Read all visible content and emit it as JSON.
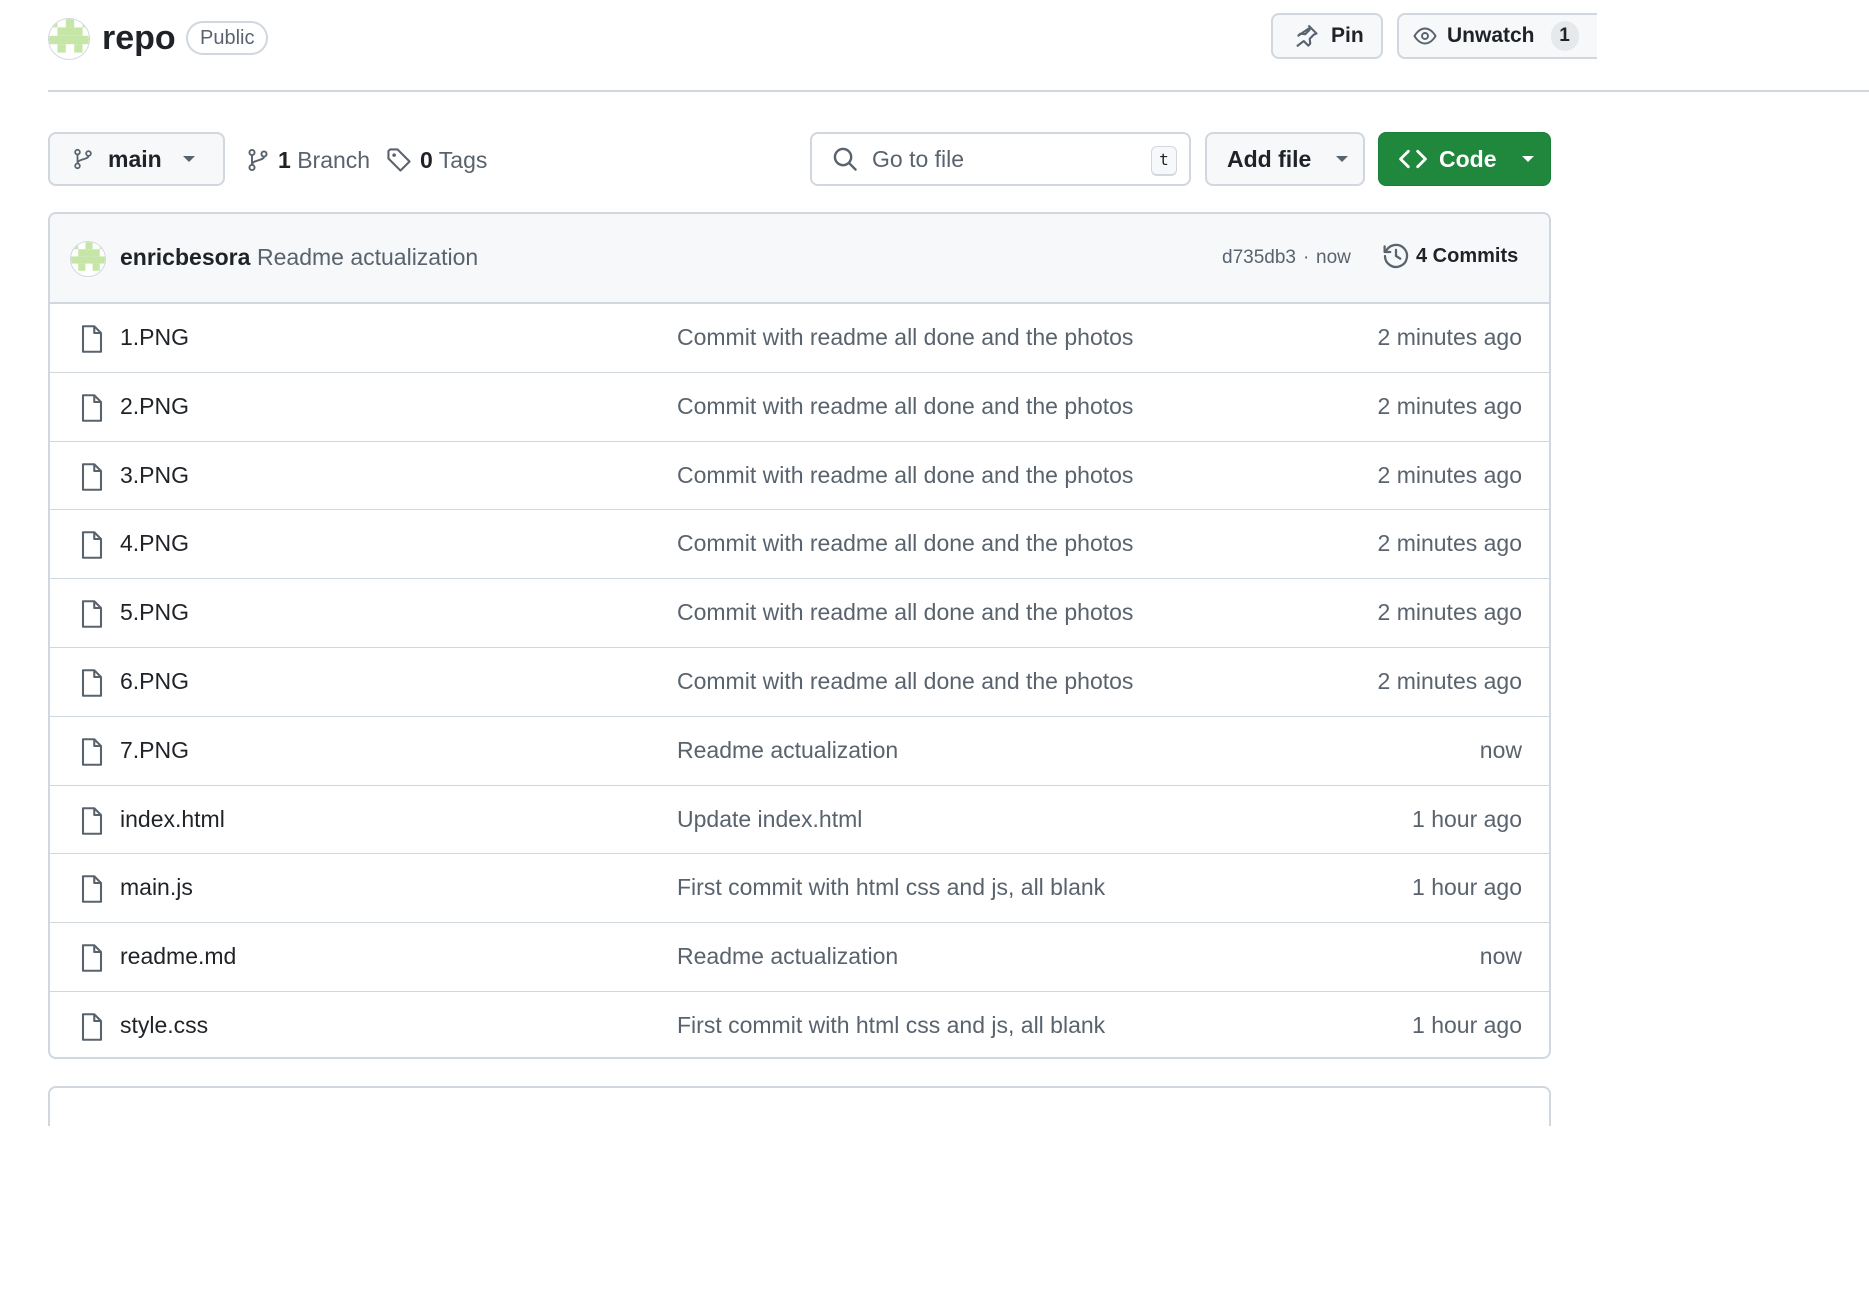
{
  "repo": {
    "name": "repo",
    "visibility": "Public",
    "pin_label": "Pin",
    "watch_label": "Unwatch",
    "watch_count": "1"
  },
  "toolbar": {
    "branch": "main",
    "branches_count": "1",
    "branches_label": "Branch",
    "tags_count": "0",
    "tags_label": "Tags",
    "search_placeholder": "Go to file",
    "search_shortcut": "t",
    "add_file_label": "Add file",
    "code_label": "Code"
  },
  "latest_commit": {
    "author": "enricbesora",
    "message": "Readme actualization",
    "sha": "d735db3",
    "separator": "·",
    "time": "now",
    "commits_label": "4 Commits"
  },
  "files": [
    {
      "name": "1.PNG",
      "commit": "Commit with readme all done and the photos",
      "age": "2 minutes ago"
    },
    {
      "name": "2.PNG",
      "commit": "Commit with readme all done and the photos",
      "age": "2 minutes ago"
    },
    {
      "name": "3.PNG",
      "commit": "Commit with readme all done and the photos",
      "age": "2 minutes ago"
    },
    {
      "name": "4.PNG",
      "commit": "Commit with readme all done and the photos",
      "age": "2 minutes ago"
    },
    {
      "name": "5.PNG",
      "commit": "Commit with readme all done and the photos",
      "age": "2 minutes ago"
    },
    {
      "name": "6.PNG",
      "commit": "Commit with readme all done and the photos",
      "age": "2 minutes ago"
    },
    {
      "name": "7.PNG",
      "commit": "Readme actualization",
      "age": "now"
    },
    {
      "name": "index.html",
      "commit": "Update index.html",
      "age": "1 hour ago"
    },
    {
      "name": "main.js",
      "commit": "First commit with html css and js, all blank",
      "age": "1 hour ago"
    },
    {
      "name": "readme.md",
      "commit": "Readme actualization",
      "age": "now"
    },
    {
      "name": "style.css",
      "commit": "First commit with html css and js, all blank",
      "age": "1 hour ago"
    }
  ],
  "colors": {
    "accent_green": "#1f883d",
    "border": "#d0d7de",
    "muted_text": "#59636e",
    "avatar_identicon": "#c6e6a8"
  },
  "icons": {
    "branch": "git-branch-icon",
    "tag": "tag-icon",
    "search": "search-icon",
    "code": "code-icon",
    "history": "history-icon",
    "file": "file-icon",
    "pin": "pin-icon",
    "eye": "eye-icon"
  }
}
